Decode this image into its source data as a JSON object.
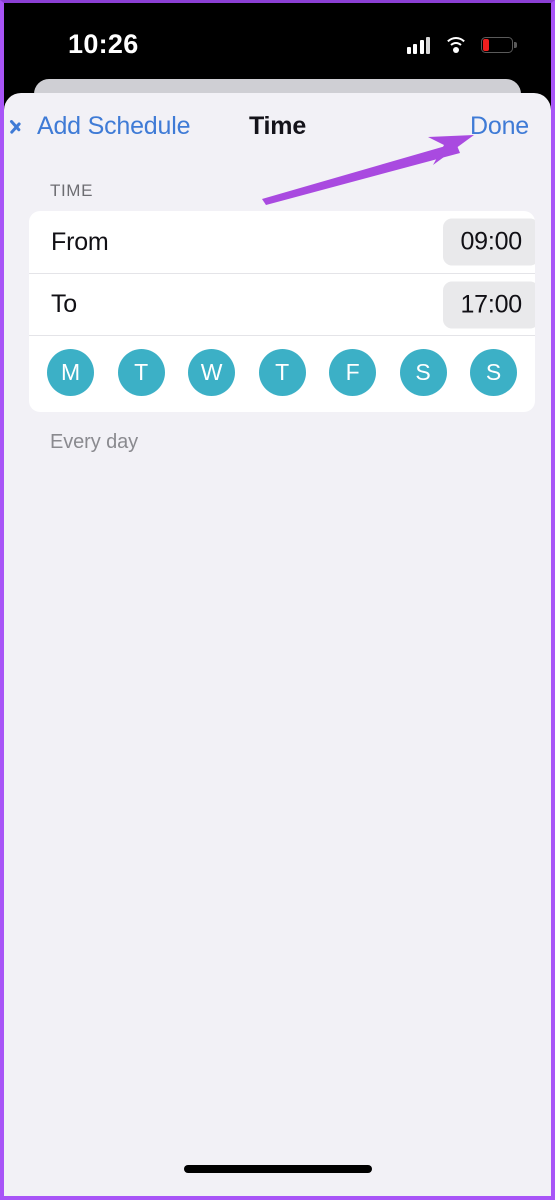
{
  "status_bar": {
    "time": "10:26",
    "cellular_icon": "cellular-bars-icon",
    "wifi_icon": "wifi-icon",
    "battery_icon": "battery-low-icon",
    "battery_level_percent": 18,
    "battery_color": "#f01e1e"
  },
  "nav": {
    "back_label": "Add Schedule",
    "back_icon": "chevron-left-icon",
    "title": "Time",
    "done_label": "Done",
    "accent_color": "#3f7bd6"
  },
  "section": {
    "header": "TIME"
  },
  "time_rows": [
    {
      "label": "From",
      "value": "09:00"
    },
    {
      "label": "To",
      "value": "17:00"
    }
  ],
  "weekdays": [
    {
      "letter": "M",
      "name": "monday",
      "selected": true
    },
    {
      "letter": "T",
      "name": "tuesday",
      "selected": true
    },
    {
      "letter": "W",
      "name": "wednesday",
      "selected": true
    },
    {
      "letter": "T",
      "name": "thursday",
      "selected": true
    },
    {
      "letter": "F",
      "name": "friday",
      "selected": true
    },
    {
      "letter": "S",
      "name": "saturday",
      "selected": true
    },
    {
      "letter": "S",
      "name": "sunday",
      "selected": true
    }
  ],
  "weekday_selected_color": "#3cb0c6",
  "footer": {
    "repeat_summary": "Every day"
  },
  "annotation": {
    "arrow_color": "#a94ae0",
    "points_to": "Done",
    "frame_color": "#a855f7"
  }
}
